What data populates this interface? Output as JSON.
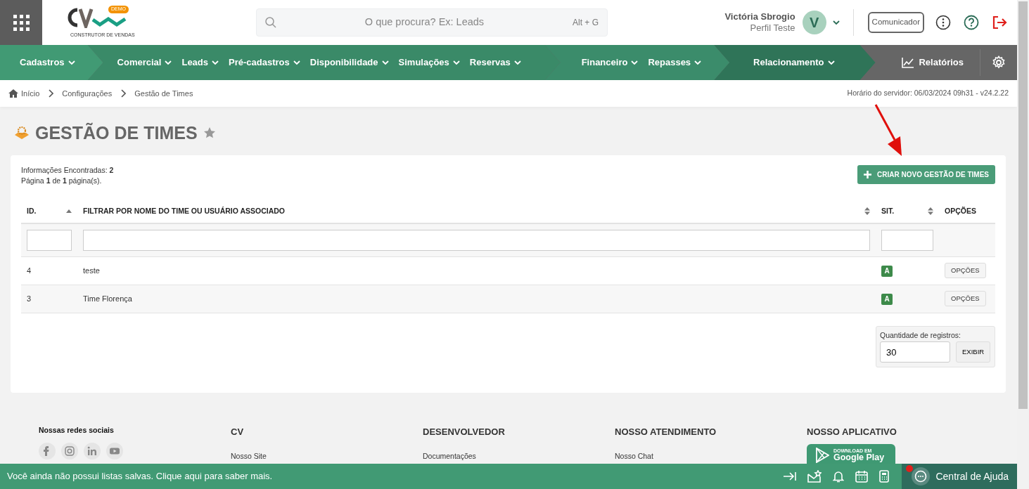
{
  "header": {
    "search_placeholder": "O que procura? Ex: Leads",
    "search_shortcut": "Alt + G",
    "user_name": "Victória Sbrogio",
    "user_profile": "Perfil Teste",
    "avatar_initial": "V",
    "communicator_button": "Comunicador",
    "logo_badge": "DEMO",
    "logo_caption": "CONSTRUTOR DE VENDAS"
  },
  "nav": {
    "segments": [
      {
        "items": [
          "Cadastros"
        ]
      },
      {
        "items": [
          "Comercial",
          "Leads",
          "Pré-cadastros",
          "Disponibilidade",
          "Simulações",
          "Reservas"
        ]
      },
      {
        "items": [
          "Financeiro",
          "Repasses"
        ]
      },
      {
        "items": [
          "Relacionamento"
        ]
      }
    ],
    "reports": "Relatórios"
  },
  "breadcrumb": {
    "items": [
      "Início",
      "Configurações",
      "Gestão de Times"
    ],
    "server_time": "Horário do servidor: 06/03/2024 09h31 - v24.2.22"
  },
  "page_title": "GESTÃO DE TIMES",
  "card": {
    "info": [
      "Informações Encontradas: **2**",
      "Página **1** de **1** página(s)."
    ],
    "create_button": "CRIAR NOVO GESTÃO DE TIMES",
    "columns": [
      {
        "label": "ID.",
        "sortable": true,
        "sorted_ascending": true,
        "kind": "text"
      },
      {
        "label": "FILTRAR POR NOME DO TIME OU USUÁRIO ASSOCIADO",
        "sortable": true,
        "sorted_ascending": false,
        "kind": "text"
      },
      {
        "label": "SIT.",
        "sortable": true,
        "sorted_ascending": false,
        "kind": "select"
      },
      {
        "label": "OPÇÕES",
        "sortable": false,
        "kind": "plain"
      }
    ],
    "rows": [
      {
        "id": "4",
        "name": "teste",
        "status": "A",
        "options": "OPÇÕES"
      },
      {
        "id": "3",
        "name": "Time Florença",
        "status": "A",
        "options": "OPÇÕES"
      }
    ],
    "records_label": "Quantidade de registros:",
    "records_value": "30",
    "show_button": "EXIBIR"
  },
  "footer": {
    "social_title": "Nossas redes sociais",
    "columns": [
      {
        "title": "CV",
        "links": [
          "Nosso Site"
        ]
      },
      {
        "title": "DESENVOLVEDOR",
        "links": [
          "Documentações"
        ]
      },
      {
        "title": "NOSSO ATENDIMENTO",
        "links": [
          "Nosso Chat"
        ]
      },
      {
        "title": "NOSSO APLICATIVO",
        "app_small": "DOWNLOAD EM",
        "app_store": "Google Play"
      }
    ]
  },
  "bottom_bar": {
    "message": "Você ainda não possui listas salvas. Clique aqui para saber mais.",
    "help": "Central de Ajuda",
    "help_notification": true
  }
}
